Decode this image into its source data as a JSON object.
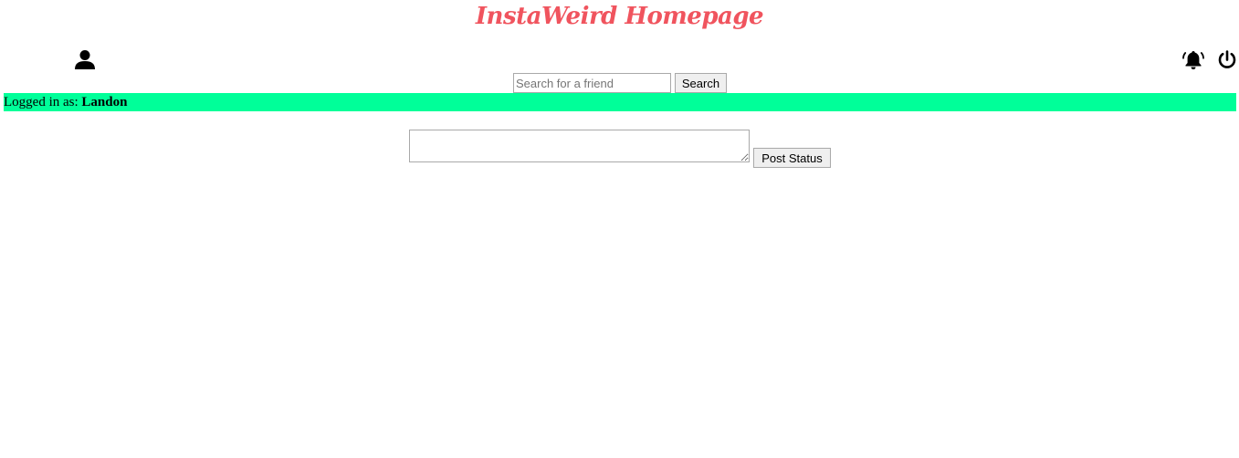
{
  "header": {
    "title": "InstaWeird Homepage",
    "title_color": "#f0545e"
  },
  "icons": {
    "profile": "user-icon",
    "notifications": "bell-icon",
    "logout": "power-icon"
  },
  "search": {
    "placeholder": "Search for a friend",
    "value": "",
    "button_label": "Search"
  },
  "status_bar": {
    "prefix": "Logged in as:",
    "username": "Landon",
    "background": "#00ff99"
  },
  "post": {
    "textarea_value": "",
    "button_label": "Post Status"
  }
}
